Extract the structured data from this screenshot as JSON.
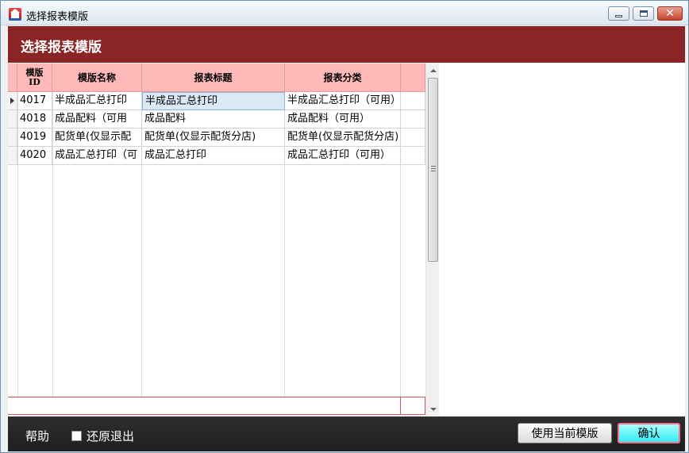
{
  "window": {
    "title": "选择报表模版",
    "icon": "app-house-icon"
  },
  "header": {
    "title": "选择报表模版",
    "background": "#8b2525"
  },
  "grid": {
    "columns": [
      {
        "label_line1": "模版",
        "label_line2": "ID"
      },
      {
        "label": "模版名称"
      },
      {
        "label": "报表标题"
      },
      {
        "label": "报表分类"
      }
    ],
    "header_color": "#ffb9b9",
    "rows": [
      {
        "id": "4017",
        "name": "半成品汇总打印",
        "title": "半成品汇总打印",
        "category": "半成品汇总打印（可用）"
      },
      {
        "id": "4018",
        "name": "成品配料（可用",
        "title": "成品配料",
        "category": "成品配料（可用）"
      },
      {
        "id": "4019",
        "name": "配货单(仅显示配",
        "title": "配货单(仅显示配货分店)",
        "category": "配货单(仅显示配货分店)"
      },
      {
        "id": "4020",
        "name": "成品汇总打印（可",
        "title": "成品汇总打印",
        "category": "成品汇总打印（可用）"
      }
    ],
    "current_row": 0
  },
  "footer": {
    "help_label": "帮助",
    "restore_exit_label": "还原退出",
    "restore_exit_checked": false,
    "use_current_label": "使用当前模版",
    "confirm_label": "确认"
  }
}
